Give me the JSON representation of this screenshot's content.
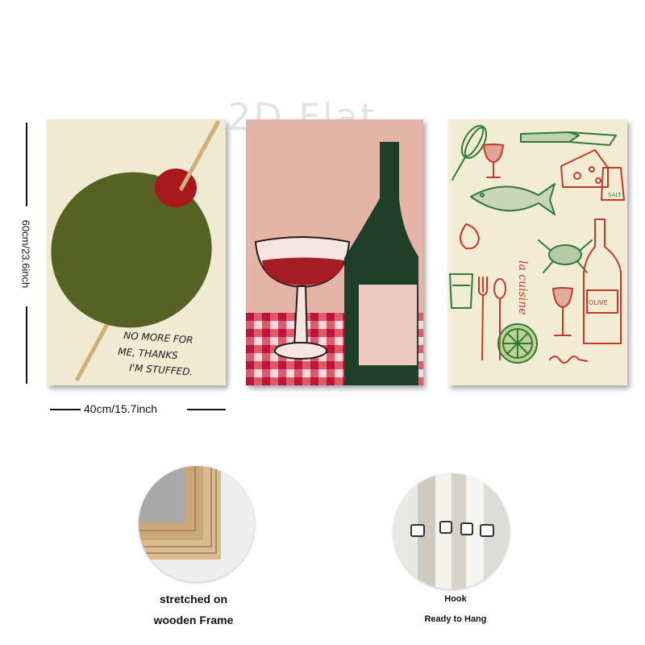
{
  "watermark": "2D Flat",
  "dimensions": {
    "height_label": "60cm/23.6inch",
    "width_label": "40cm/15.7inch"
  },
  "panels": [
    {
      "subject": "olive-on-toothpick",
      "text_lines": [
        "NO MORE FOR",
        "ME, THANKS",
        "I'M STUFFED."
      ],
      "colors": {
        "background": "#f1ead3",
        "olive": "#556224",
        "pimento": "#a8181e",
        "toothpick": "#cfb077"
      }
    },
    {
      "subject": "wine-glass-and-bottle",
      "colors": {
        "background": "#e4b4a6",
        "bottle": "#1f3f2a",
        "wine": "#a41c24",
        "tablecloth": "#d8394f"
      }
    },
    {
      "subject": "kitchen-doodles",
      "script_text": "la cuisine",
      "bottle_label": "OLIVE",
      "shaker_label": "SALT",
      "colors": {
        "background": "#f2ecd5",
        "green_ink": "#2e7a3a",
        "red_ink": "#c23a2e"
      }
    }
  ],
  "features": [
    {
      "icon": "wooden-frame-corner",
      "caption_lines": [
        "stretched on",
        "wooden Frame"
      ]
    },
    {
      "icon": "hook-detail",
      "caption_lines": [
        "Hook",
        "Ready to Hang"
      ]
    }
  ]
}
